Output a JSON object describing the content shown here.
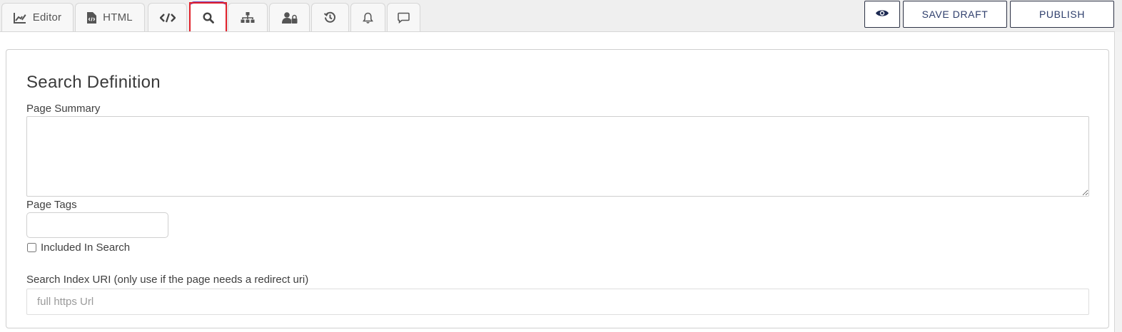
{
  "tabs": [
    {
      "icon": "edit-chart-icon",
      "label": "Editor"
    },
    {
      "icon": "html-file-icon",
      "label": "HTML"
    },
    {
      "icon": "code-icon",
      "label": ""
    },
    {
      "icon": "search-icon",
      "label": "",
      "active": true
    },
    {
      "icon": "sitemap-icon",
      "label": ""
    },
    {
      "icon": "user-lock-icon",
      "label": ""
    },
    {
      "icon": "history-icon",
      "label": ""
    },
    {
      "icon": "bell-icon",
      "label": ""
    },
    {
      "icon": "comment-icon",
      "label": ""
    }
  ],
  "actions": {
    "preview_icon": "eye-icon",
    "save_draft": "SAVE DRAFT",
    "publish": "PUBLISH"
  },
  "form": {
    "title": "Search Definition",
    "page_summary_label": "Page Summary",
    "page_summary_value": "",
    "page_tags_label": "Page Tags",
    "page_tags_value": "",
    "included_in_search_label": "Included In Search",
    "included_in_search_checked": false,
    "search_index_uri_label": "Search Index URI (only use if the page needs a redirect uri)",
    "search_index_uri_placeholder": "full https Url",
    "search_index_uri_value": ""
  },
  "colors": {
    "active_tab_accent": "#7b3fb8",
    "highlight_box": "#e0202a",
    "button_text": "#2d3d6b"
  }
}
